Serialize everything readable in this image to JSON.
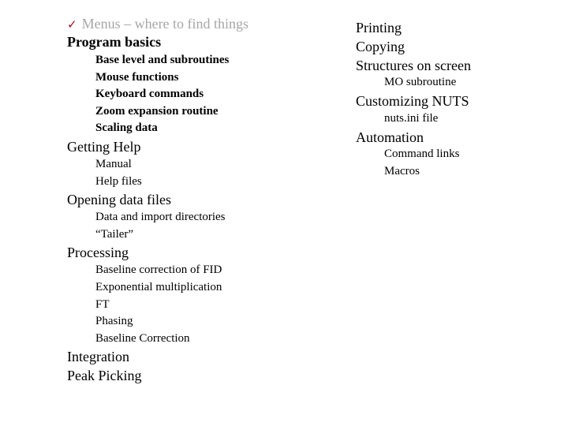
{
  "left_column": {
    "items": [
      {
        "label": "Menus – where to find things",
        "level": 1,
        "done": true,
        "icon": "checkmark-icon"
      },
      {
        "label": "Program basics",
        "level": 1,
        "bold": true
      },
      {
        "label": "Base level and subroutines",
        "level": 2,
        "bold": true
      },
      {
        "label": "Mouse functions",
        "level": 2,
        "bold": true
      },
      {
        "label": "Keyboard commands",
        "level": 2,
        "bold": true
      },
      {
        "label": "Zoom expansion routine",
        "level": 2,
        "bold": true
      },
      {
        "label": "Scaling data",
        "level": 2,
        "bold": true
      },
      {
        "label": "Getting Help",
        "level": 1
      },
      {
        "label": "Manual",
        "level": 2
      },
      {
        "label": "Help files",
        "level": 2
      },
      {
        "label": "Opening data files",
        "level": 1
      },
      {
        "label": "Data and import directories",
        "level": 2
      },
      {
        "label": "“Tailer”",
        "level": 2
      },
      {
        "label": "Processing",
        "level": 1
      },
      {
        "label": "Baseline correction of FID",
        "level": 2
      },
      {
        "label": "Exponential multiplication",
        "level": 2
      },
      {
        "label": "FT",
        "level": 2
      },
      {
        "label": "Phasing",
        "level": 2
      },
      {
        "label": "Baseline Correction",
        "level": 2
      },
      {
        "label": "Integration",
        "level": 1
      },
      {
        "label": "Peak Picking",
        "level": 1
      }
    ]
  },
  "right_column": {
    "items": [
      {
        "label": "Printing",
        "level": 1
      },
      {
        "label": "Copying",
        "level": 1
      },
      {
        "label": "Structures on screen",
        "level": 1
      },
      {
        "label": "MO subroutine",
        "level": 2
      },
      {
        "label": "Customizing NUTS",
        "level": 1
      },
      {
        "label": "nuts.ini file",
        "level": 2
      },
      {
        "label": "Automation",
        "level": 1
      },
      {
        "label": "Command links",
        "level": 2
      },
      {
        "label": "Macros",
        "level": 2
      }
    ]
  },
  "colors": {
    "checkmark": "#a10d1c",
    "done_text": "#a6a6a6"
  },
  "checkmark_glyph": "✓"
}
